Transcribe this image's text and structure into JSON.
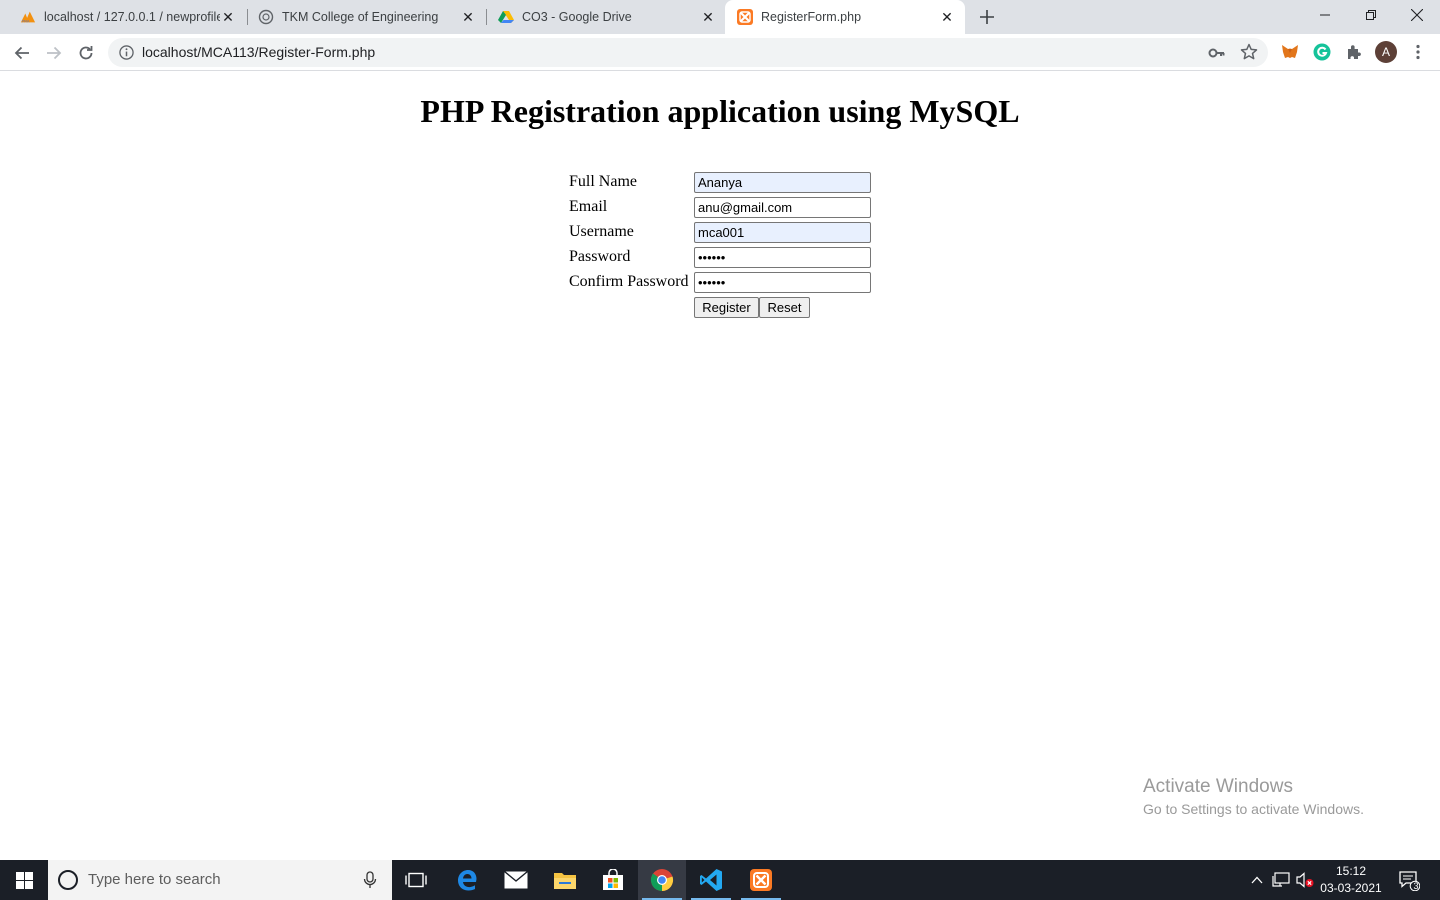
{
  "browser": {
    "tabs": [
      {
        "title": "localhost / 127.0.0.1 / newprofile",
        "favicon": "phpmyadmin-icon",
        "active": false
      },
      {
        "title": "TKM College of Engineering",
        "favicon": "globe-icon",
        "active": false
      },
      {
        "title": "CO3 - Google Drive",
        "favicon": "google-drive-icon",
        "active": false
      },
      {
        "title": "RegisterForm.php",
        "favicon": "xampp-icon",
        "active": true
      }
    ],
    "address_bar": {
      "url": "localhost/MCA113/Register-Form.php"
    },
    "profile_initial": "A",
    "accent_color": "#1a73e8"
  },
  "page": {
    "heading": "PHP Registration application using MySQL",
    "form": {
      "fields": [
        {
          "label": "Full Name",
          "value": "Ananya",
          "type": "text",
          "autofilled": true
        },
        {
          "label": "Email",
          "value": "anu@gmail.com",
          "type": "text",
          "autofilled": false
        },
        {
          "label": "Username",
          "value": "mca001",
          "type": "text",
          "autofilled": true
        },
        {
          "label": "Password",
          "value": "••••••",
          "type": "password",
          "autofilled": false
        },
        {
          "label": "Confirm Password",
          "value": "••••••",
          "type": "password",
          "autofilled": false
        }
      ],
      "register_label": "Register",
      "reset_label": "Reset"
    }
  },
  "watermark": {
    "line1": "Activate Windows",
    "line2": "Go to Settings to activate Windows."
  },
  "taskbar": {
    "search_placeholder": "Type here to search",
    "apps": [
      "task-view-icon",
      "edge-icon",
      "mail-icon",
      "file-explorer-icon",
      "store-icon",
      "chrome-icon",
      "vscode-icon",
      "xampp-icon"
    ],
    "clock": {
      "time": "15:12",
      "date": "03-03-2021"
    },
    "notification_count": "3"
  }
}
